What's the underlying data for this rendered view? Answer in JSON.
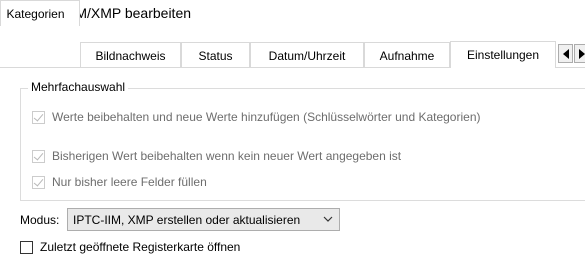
{
  "window": {
    "title": "IPTC-IIM/XMP bearbeiten",
    "icon": "xnview-app-icon"
  },
  "tabs": [
    {
      "label": "Kategorien",
      "active": false
    },
    {
      "label": "Bildnachweis",
      "active": false
    },
    {
      "label": "Status",
      "active": false
    },
    {
      "label": "Datum/Uhrzeit",
      "active": false
    },
    {
      "label": "Aufnahme",
      "active": false
    },
    {
      "label": "Einstellungen",
      "active": true
    }
  ],
  "tab_scroll": {
    "left_icon": "triangle-left-icon",
    "right_icon": "triangle-right-icon"
  },
  "group": {
    "title": "Mehrfachauswahl",
    "options": [
      {
        "label": "Werte beibehalten und neue Werte hinzufügen (Schlüsselwörter und Kategorien)",
        "checked": true,
        "enabled": false
      },
      {
        "label": "Bisherigen Wert beibehalten wenn kein neuer Wert angegeben ist",
        "checked": true,
        "enabled": false
      },
      {
        "label": "Nur bisher leere Felder füllen",
        "checked": true,
        "enabled": false
      }
    ]
  },
  "modus": {
    "label": "Modus:",
    "selected": "IPTC-IIM, XMP erstellen oder aktualisieren"
  },
  "remember_tab": {
    "label": "Zuletzt geöffnete Registerkarte öffnen",
    "checked": false
  }
}
